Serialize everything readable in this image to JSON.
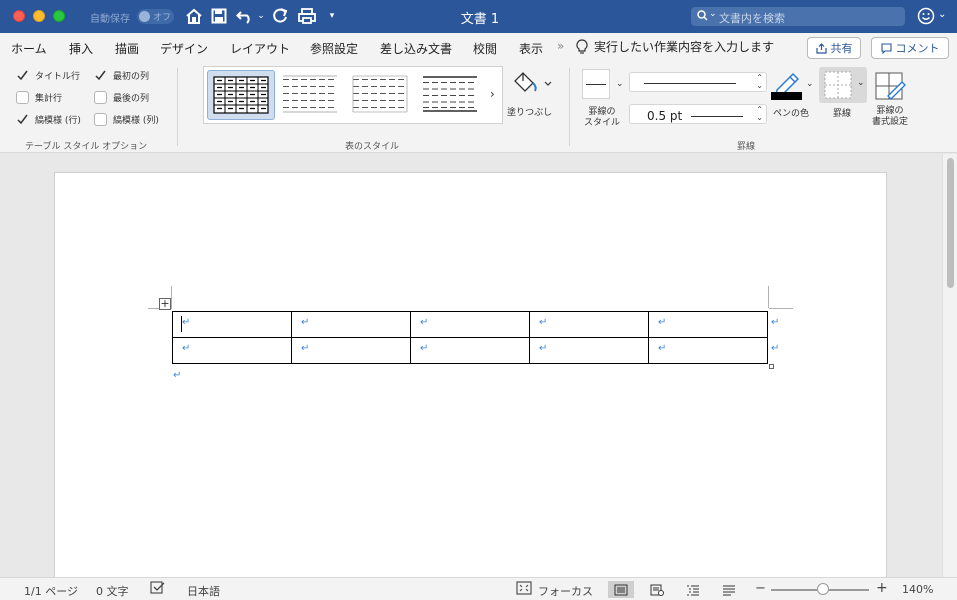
{
  "titlebar": {
    "autosave_label": "自動保存",
    "autosave_state": "オフ",
    "doc_title": "文書 1",
    "search_placeholder": "文書内を検索"
  },
  "tabs": [
    "ホーム",
    "挿入",
    "描画",
    "デザイン",
    "レイアウト",
    "参照設定",
    "差し込み文書",
    "校閲",
    "表示"
  ],
  "tell_me": "実行したい作業内容を入力します",
  "share_label": "共有",
  "comment_label": "コメント",
  "style_options": {
    "group_label": "テーブル スタイル オプション",
    "items": [
      {
        "label": "タイトル行",
        "checked": true
      },
      {
        "label": "最初の列",
        "checked": true
      },
      {
        "label": "集計行",
        "checked": false
      },
      {
        "label": "最後の列",
        "checked": false
      },
      {
        "label": "縞模様 (行)",
        "checked": true
      },
      {
        "label": "縞模様 (列)",
        "checked": false
      }
    ]
  },
  "table_styles": {
    "group_label": "表のスタイル",
    "shading_label": "塗りつぶし"
  },
  "borders": {
    "group_label": "罫線",
    "style_label": "罫線の\nスタイル",
    "weight_value": "0.5 pt",
    "pen_color_label": "ペンの色",
    "pen_color": "#000000",
    "borders_label": "罫線",
    "format_label": "罫線の\n書式設定"
  },
  "document": {
    "rows": 2,
    "cols": 5,
    "para_mark": "↵"
  },
  "status": {
    "page": "1/1 ページ",
    "words": "0 文字",
    "language": "日本語",
    "focus": "フォーカス",
    "zoom": "140%",
    "zoom_minus": "−",
    "zoom_plus": "+"
  },
  "colors": {
    "title_bar": "#2b579a",
    "para_mark": "#3c86d8"
  }
}
